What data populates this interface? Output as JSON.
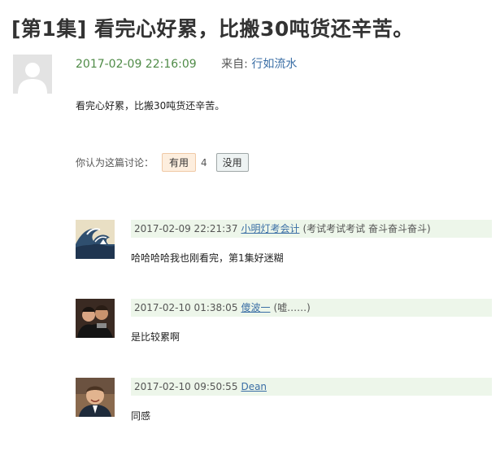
{
  "topic": {
    "title": "[第1集] 看完心好累，比搬30吨货还辛苦。"
  },
  "post": {
    "time": "2017-02-09 22:16:09",
    "source_label": "来自:",
    "source_user": "行如流水",
    "text": "看完心好累，比搬30吨货还辛苦。",
    "vote_prompt": "你认为这篇讨论：",
    "useful_label": "有用",
    "useful_count": "4",
    "useless_label": "没用"
  },
  "replies": [
    {
      "time": "2017-02-09 22:21:37",
      "user": "小明灯考会计",
      "signature": "(考试考试考试 奋斗奋斗奋斗)",
      "text": "哈哈哈哈我也刚看完，第1集好迷糊",
      "avatar_icon": "wave-painting-avatar"
    },
    {
      "time": "2017-02-10 01:38:05",
      "user": "傻波一",
      "signature": "(嘘……)",
      "text": "是比较累啊",
      "avatar_icon": "group-photo-avatar"
    },
    {
      "time": "2017-02-10 09:50:55",
      "user": "Dean",
      "signature": "",
      "text": "同感",
      "avatar_icon": "person-photo-avatar"
    }
  ]
}
